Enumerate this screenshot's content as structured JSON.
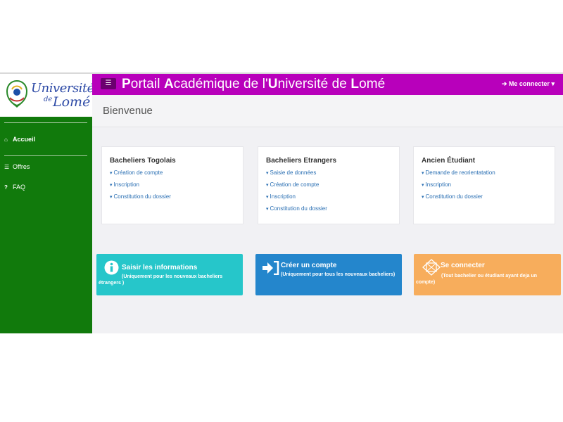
{
  "logo": {
    "line1": "Université",
    "line2": "de",
    "line3": "Lomé"
  },
  "sidebar": {
    "items": [
      {
        "label": "Accueil",
        "icon": "home-icon"
      },
      {
        "label": "Offres",
        "icon": "list-icon"
      },
      {
        "label": "FAQ",
        "icon": "question-icon"
      }
    ]
  },
  "topbar": {
    "menu_icon": "☰",
    "title": [
      {
        "cap": "P",
        "rest": "ortail "
      },
      {
        "cap": "A",
        "rest": "cadémique de l'"
      },
      {
        "cap": "U",
        "rest": "niversité de "
      },
      {
        "cap": "L",
        "rest": "omé"
      }
    ],
    "connect_label": "Me connecter"
  },
  "welcome": "Bienvenue",
  "cards": [
    {
      "title": "Bacheliers Togolais",
      "links": [
        "Création de compte",
        "Inscription",
        "Constitution du dossier"
      ]
    },
    {
      "title": "Bacheliers Etrangers",
      "links": [
        "Saisie de données",
        "Création de compte",
        "Inscription",
        "Constitution du dossier"
      ]
    },
    {
      "title": "Ancien Étudiant",
      "links": [
        "Demande de reorientatation",
        "Inscription",
        "Constitution du dossier"
      ]
    }
  ],
  "tiles": [
    {
      "title": "Saisir les informations",
      "subtitle": "(Uniquement pour les nouveaux bacheliers étrangers )",
      "color": "#26c6ca",
      "icon": "info-icon"
    },
    {
      "title": "Créer un compte",
      "subtitle": "(Uniquement pour tous les nouveaux bacheliers)",
      "color": "#2486cc",
      "icon": "sign-in-icon"
    },
    {
      "title": "Se connecter",
      "subtitle": "(Tout bachelier ou étudiant ayant deja un compte)",
      "color": "#f7ad5c",
      "icon": "connect-icon"
    }
  ],
  "colors": {
    "topbar": "#b800bb",
    "sidebar": "#117a0c",
    "link": "#2a6fb3"
  }
}
